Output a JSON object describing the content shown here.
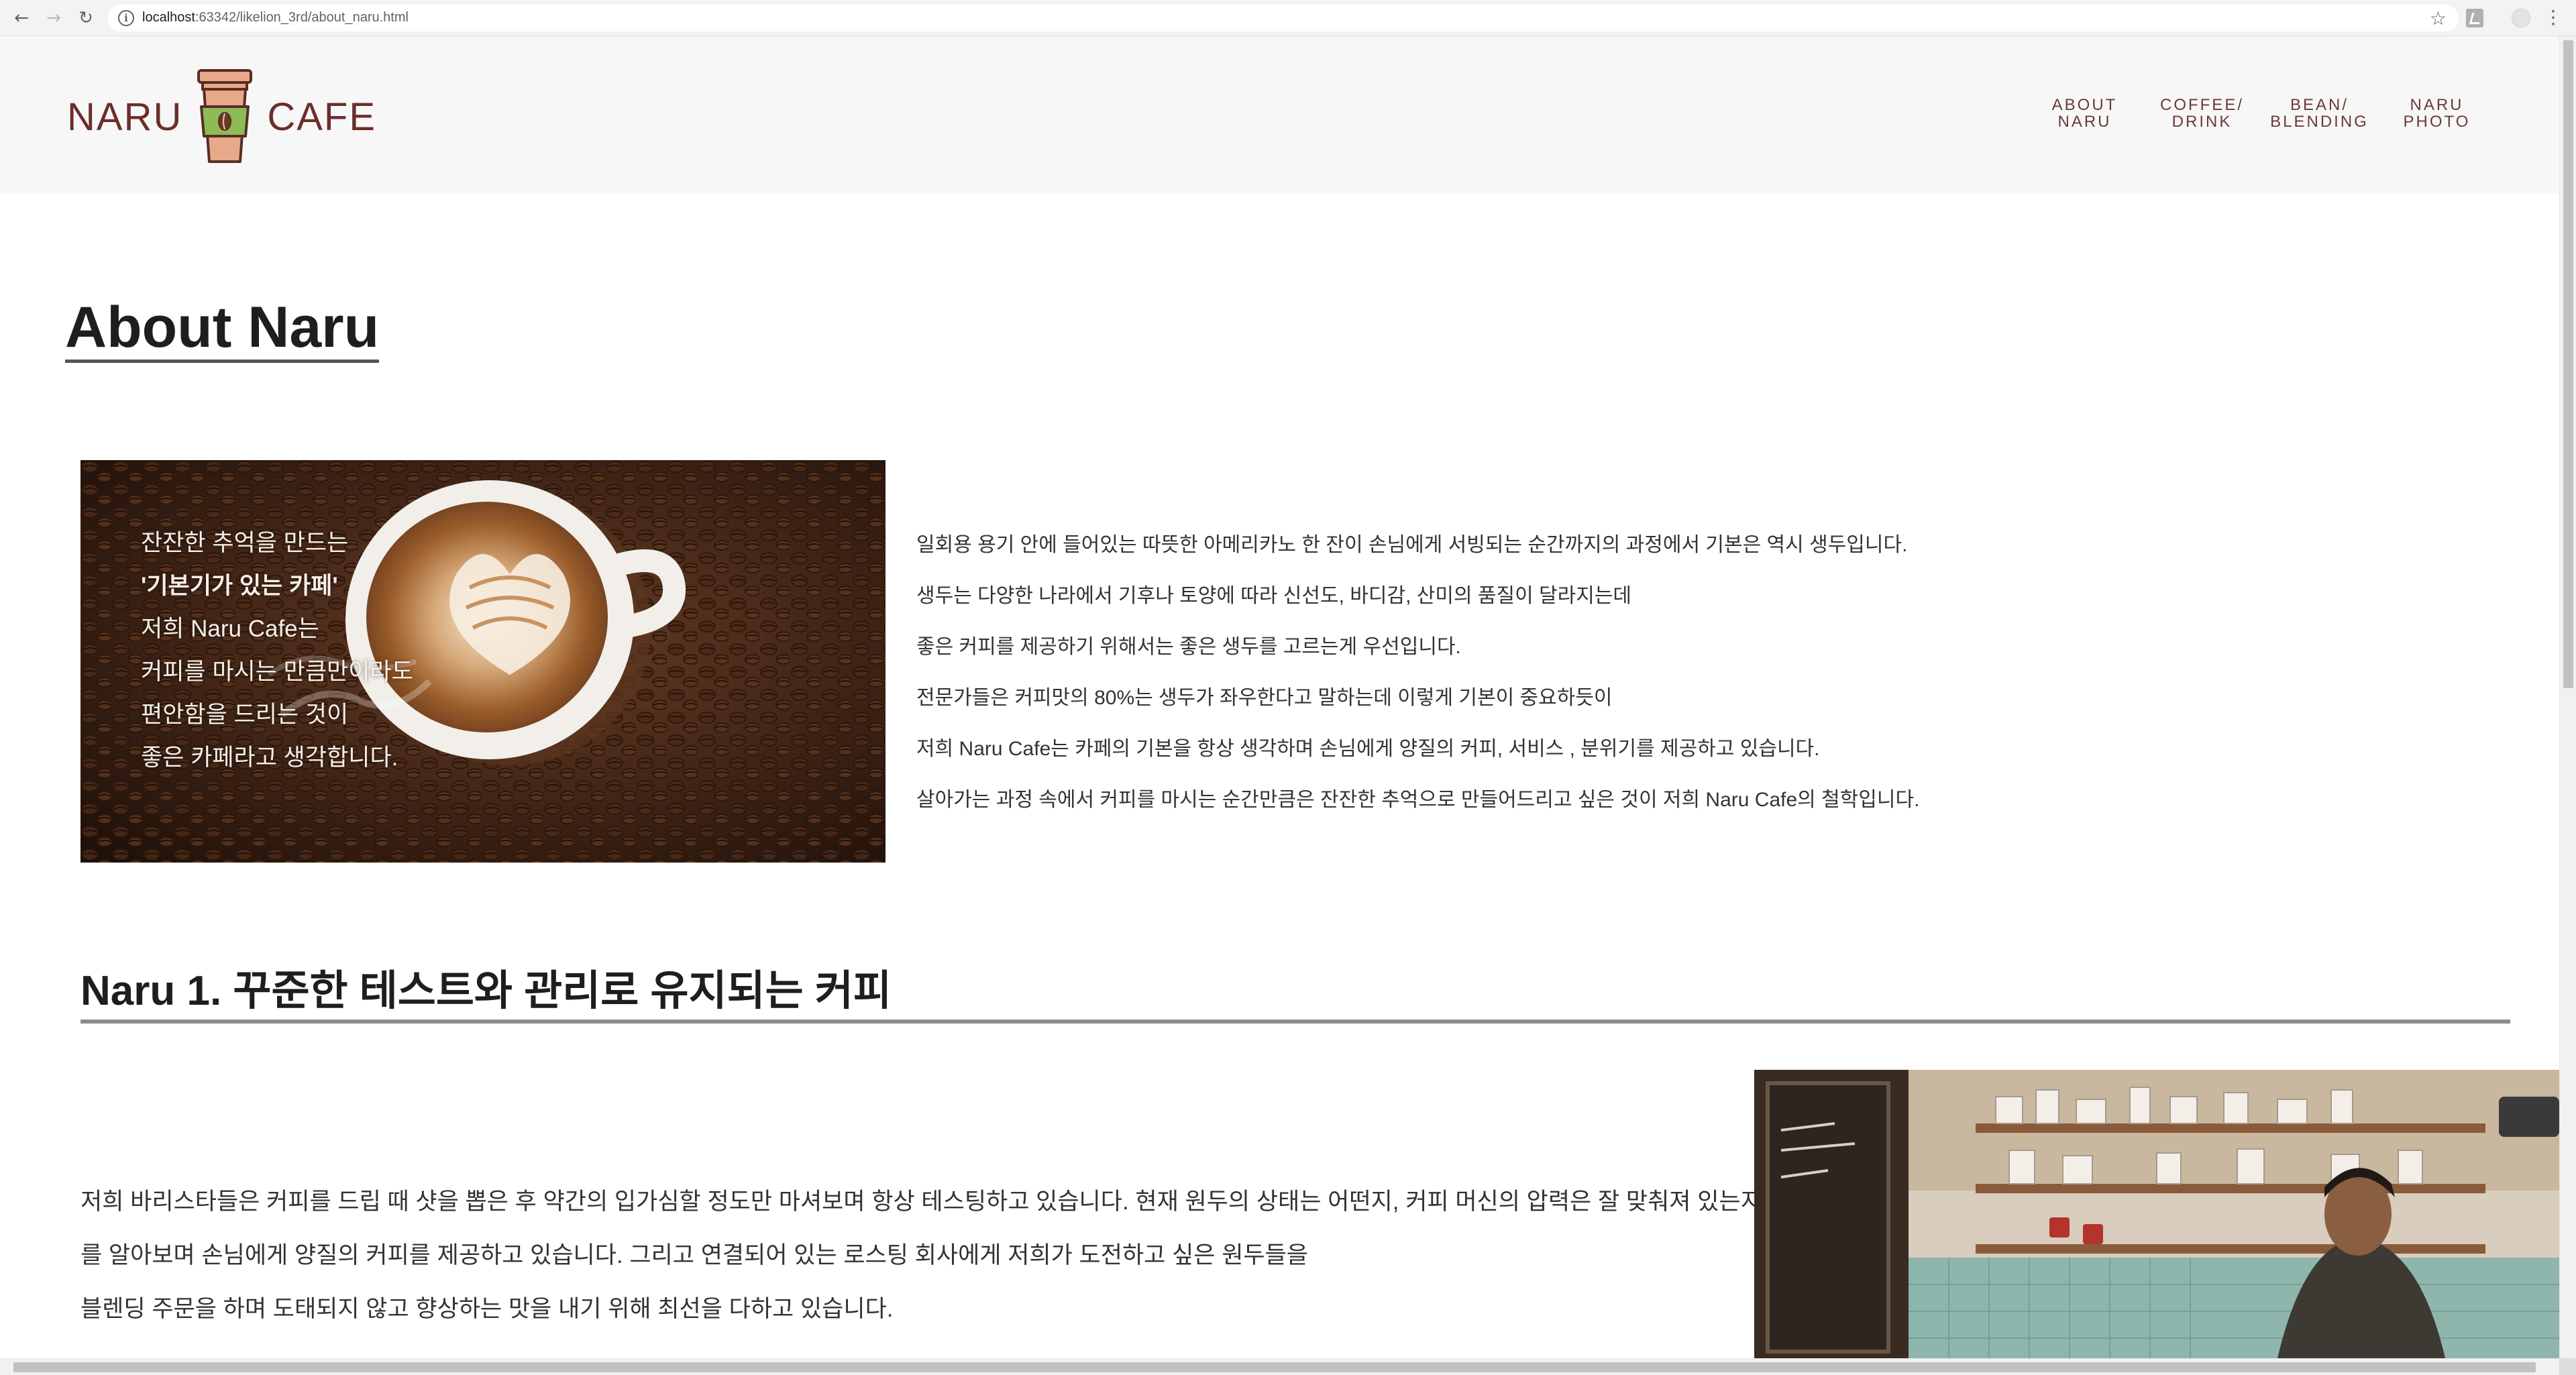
{
  "browser": {
    "url_host": "localhost",
    "url_rest": ":63342/likelion_3rd/about_naru.html",
    "back_icon": "arrow-left-icon",
    "forward_icon": "arrow-right-icon",
    "reload_icon": "reload-icon"
  },
  "header": {
    "logo_left": "NARU",
    "logo_right": "CAFE",
    "nav": [
      {
        "line1": "ABOUT",
        "line2": "NARU"
      },
      {
        "line1": "COFFEE/",
        "line2": "DRINK"
      },
      {
        "line1": "BEAN/",
        "line2": "BLENDING"
      },
      {
        "line1": "NARU",
        "line2": "PHOTO"
      }
    ]
  },
  "page": {
    "title": "About Naru"
  },
  "hero": {
    "lines": [
      "잔잔한 추억을 만드는",
      "'기본기가 있는 카페'",
      "저희 Naru Cafe는",
      "커피를 마시는 만큼만이라도",
      "편안함을 드리는 것이",
      "좋은 카페라고 생각합니다."
    ]
  },
  "intro": {
    "paragraphs": [
      "일회용 용기 안에 들어있는 따뜻한 아메리카노 한 잔이 손님에게 서빙되는 순간까지의 과정에서 기본은 역시 생두입니다.",
      "생두는 다양한 나라에서 기후나 토양에 따라 신선도, 바디감, 산미의 품질이 달라지는데",
      "좋은 커피를 제공하기 위해서는 좋은 생두를 고르는게 우선입니다.",
      "전문가들은 커피맛의 80%는 생두가 좌우한다고 말하는데 이렇게 기본이 중요하듯이",
      "저희 Naru Cafe는 카페의 기본을 항상 생각하며 손님에게 양질의 커피, 서비스 , 분위기를 제공하고 있습니다.",
      "살아가는 과정 속에서 커피를 마시는 순간만큼은 잔잔한 추억으로 만들어드리고 싶은 것이 저희 Naru Cafe의 철학입니다."
    ]
  },
  "section1": {
    "title": "Naru 1. 꾸준한 테스트와 관리로 유지되는 커피",
    "lines": [
      "저희 바리스타들은 커피를 드립 때 샷을 뽑은 후 약간의 입가심할 정도만 마셔보며 항상 테스팅하고 있습니다. 현재 원두의 상태는 어떤지, 커피 머신의 압력은 잘 맞춰져 있는지",
      "를 알아보며 손님에게 양질의 커피를 제공하고 있습니다. 그리고 연결되어 있는 로스팅 회사에게 저희가 도전하고 싶은 원두들을",
      "블렌딩 주문을 하며 도태되지 않고 향상하는 맛을 내기 위해 최선을 다하고 있습니다."
    ]
  },
  "colors": {
    "brand": "#6b2e2a",
    "cup_sleeve": "#8dbb55",
    "cup_body": "#e8a98a",
    "header_bg": "#f7f7f8"
  }
}
